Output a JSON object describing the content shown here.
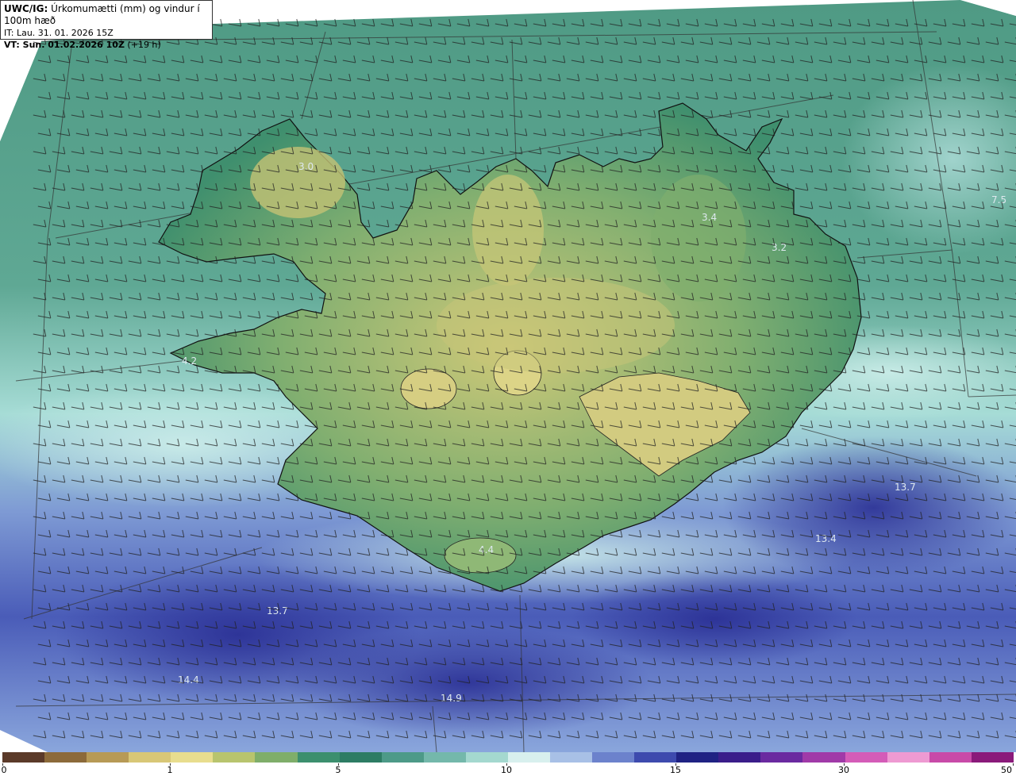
{
  "header": {
    "title_bold": "UWC/IG:",
    "title_rest": " Úrkomumætti (mm) og vindur í 100m hæð",
    "it_line": "IT: Lau. 31. 01. 2026 15Z",
    "vt_bold": "VT: Sun. 01.02.2026 10Z",
    "vt_rest": " (+19 h)"
  },
  "map": {
    "value_labels": [
      "3.0",
      "3.4",
      "3.2",
      "7.5",
      "4.2",
      "13.7",
      "13.4",
      "4.4",
      "13.7",
      "14.4",
      "14.9"
    ],
    "colors": {
      "ocean_green": "#4d9a82",
      "land_low": "#3f8f6e",
      "land_high": "#c8c46a",
      "sea_light": "#9ed6d0",
      "sea_blue": "#5b74c2",
      "sea_deep": "#2a2f94",
      "coast": "#111111"
    }
  },
  "colorbar": {
    "tick_labels": [
      "0",
      "1",
      "5",
      "10",
      "15",
      "30",
      "50"
    ],
    "colors": [
      "#5b3a29",
      "#8c6a3a",
      "#b79a56",
      "#d8c777",
      "#e8dd8e",
      "#b8c46e",
      "#7fae6a",
      "#3c8f6e",
      "#2d7c64",
      "#4d9a88",
      "#74b8ab",
      "#a4d8cf",
      "#d8f0ee",
      "#a8c0e6",
      "#6c82cc",
      "#3d4aae",
      "#1f2283",
      "#3a1d8a",
      "#6a2aa0",
      "#a03aa8",
      "#d45cb8",
      "#ee9ad2",
      "#c84aa8",
      "#8a1a7a"
    ]
  }
}
